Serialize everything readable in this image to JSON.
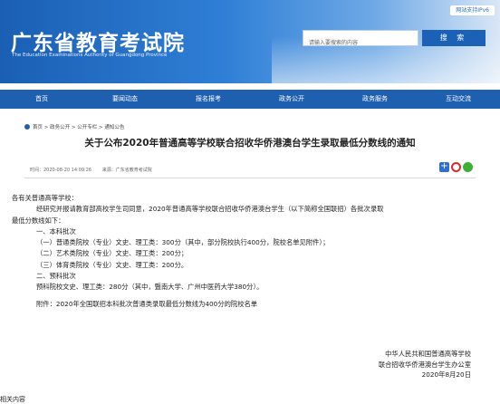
{
  "header": {
    "ipv6_badge": "网站支持IPv6",
    "site_title": "广东省教育考试院",
    "site_subtitle": "The Education Examinations Authority of Guangdong Province",
    "search_placeholder": "请输入要搜索的内容",
    "search_button": "搜 索"
  },
  "nav": [
    "首页",
    "要闻动态",
    "报名报考",
    "政务公开",
    "政务服务",
    "互动交流"
  ],
  "breadcrumb": "首页 > 政务公开 > 公开专栏 > 通知公告",
  "article": {
    "title": "关于公布2020年普通高等学校联合招收华侨港澳台学生录取最低分数线的通知",
    "time": "时间：2020-08-20 14:09:26",
    "source": "来源：广东省教育考试院",
    "greeting": "各有关普通高等学校：",
    "para1": "经研究并报请教育部高校学生司同意，2020年普通高等学校联合招收华侨港澳台学生（以下简称全国联招）各批次录取",
    "para1_cont": "最低分数线如下：",
    "section1": "一、本科批次",
    "item1": "（一）普通类院校（专业）文史、理工类：300分（其中，部分院校执行400分，院校名单见附件）；",
    "item2": "（二）艺术类院校（专业）文史、理工类：200分；",
    "item3": "（三）体育类院校（专业）文史、理工类：200分。",
    "section2": "二、预科批次",
    "item4": "预科院校文史、理工类：280分（其中，暨南大学、广州中医药大学380分）。",
    "attachment": "附件：2020年全国联招本科批次普通类录取最低分数线为400分的院校名单",
    "sign1": "中华人民共和国普通高等学校",
    "sign2": "联合招收华侨港澳台学生办公室",
    "sign_date": "2020年8月20日"
  },
  "footer_fragment": "相关内容"
}
